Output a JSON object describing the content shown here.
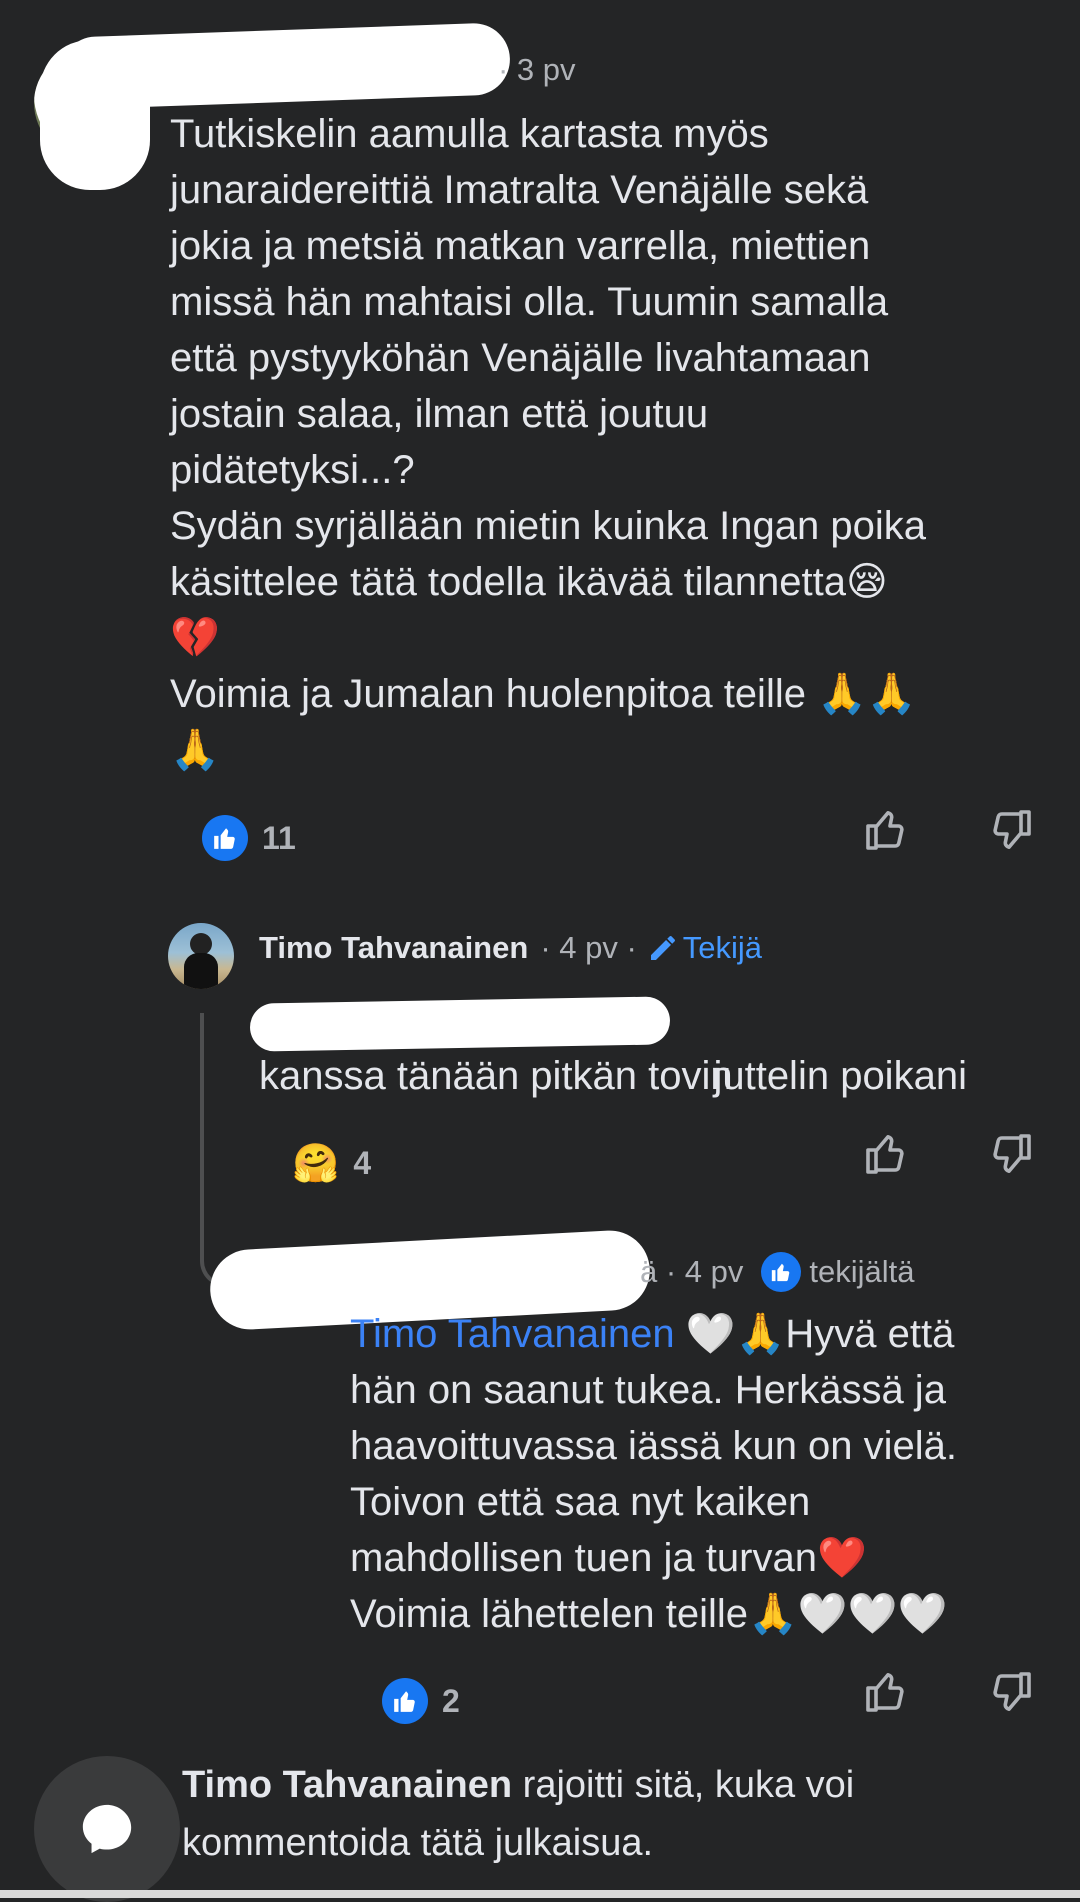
{
  "comment1": {
    "time": "· 3 pv",
    "lines": [
      "Tutkiskelin aamulla kartasta myös",
      "junaraidereittiä Imatralta Venäjälle sekä",
      "jokia ja metsiä matkan varrella, miettien",
      "missä hän mahtaisi olla. Tuumin samalla",
      "että pystyyköhän Venäjälle livahtamaan",
      "jostain salaa, ilman että joutuu",
      "pidätetyksi...?",
      "Sydän syrjällään mietin kuinka Ingan poika",
      "käsittelee tätä todella ikävää tilannetta😪",
      "💔",
      "Voimia ja Jumalan huolenpitoa teille 🙏🙏",
      "🙏"
    ],
    "like_count": "11"
  },
  "reply1": {
    "author": "Timo Tahvanainen",
    "time": "· 4 pv ·",
    "badge_label": "Tekijä",
    "text_line1": "juttelin poikani",
    "text_line2": "kanssa tänään pitkän tovin",
    "reaction_emoji": "🤗",
    "reaction_count": "4"
  },
  "reply2": {
    "time_suffix": "ä · 4 pv",
    "liked_by_label": "tekijältä",
    "mention": "Timo Tahvanainen",
    "line1_rest": " 🤍🙏Hyvä että",
    "lines": [
      "hän on saanut tukea. Herkässä ja",
      "haavoittuvassa iässä kun on vielä.",
      "Toivon että saa nyt kaiken",
      "mahdollisen tuen ja turvan❤️",
      "Voimia lähettelen teille🙏🤍🤍🤍"
    ],
    "like_count": "2"
  },
  "notice": {
    "author": "Timo Tahvanainen",
    "line1_rest": " rajoitti sitä, kuka voi",
    "line2": "kommentoida tätä julkaisua."
  },
  "colors": {
    "background": "#242526",
    "text": "#e4e6eb",
    "muted": "#b0b3b8",
    "accent": "#3b82f6",
    "like_blue": "#1877f2"
  },
  "icons": [
    "like-reaction-icon",
    "thumbs-up-icon",
    "thumbs-down-icon",
    "pencil-icon",
    "hug-reaction-icon",
    "chat-bubble-icon"
  ]
}
